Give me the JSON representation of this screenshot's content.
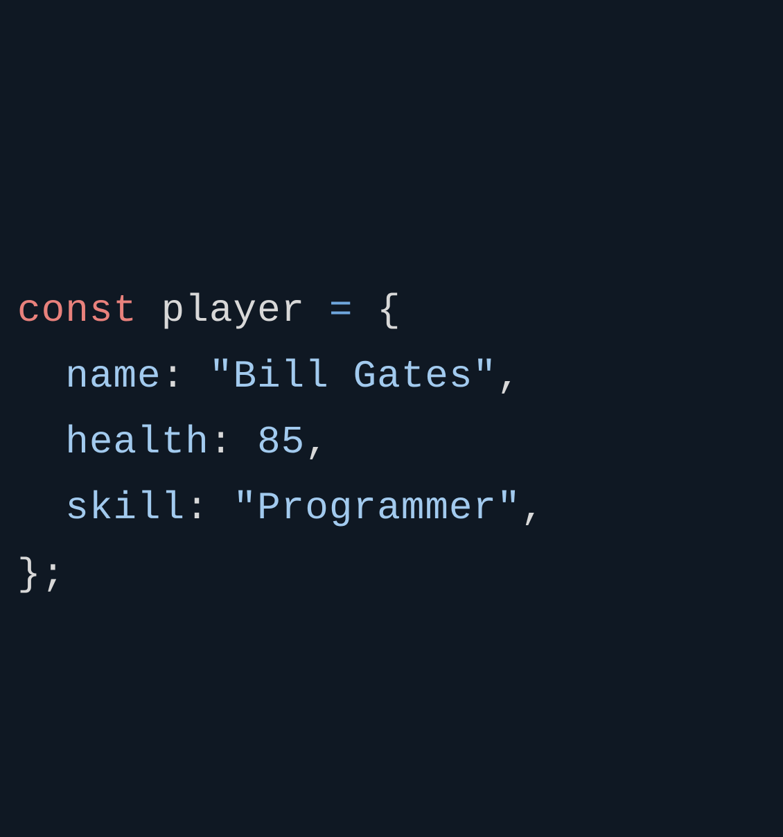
{
  "code": {
    "keyword": "const",
    "variable": "player",
    "operator": "=",
    "brace_open": "{",
    "brace_close_semi": "};",
    "lines": [
      {
        "property": "name",
        "colon": ":",
        "value_string": "\"Bill Gates\"",
        "comma": ","
      },
      {
        "property": "health",
        "colon": ":",
        "value_number": "85",
        "comma": ","
      },
      {
        "property": "skill",
        "colon": ":",
        "value_string": "\"Programmer\"",
        "comma": ","
      }
    ]
  }
}
